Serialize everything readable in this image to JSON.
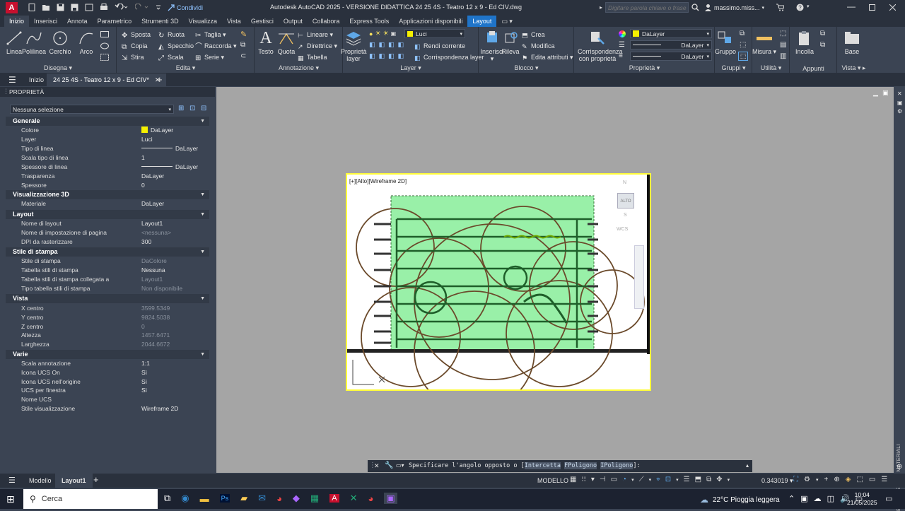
{
  "titlebar": {
    "app_logo": "A",
    "share_label": "Condividi",
    "title": "Autodesk AutoCAD 2025 - VERSIONE DIDATTICA   24 25 4S - Teatro 12 x 9 - Ed CIV.dwg",
    "search_placeholder": "Digitare parola chiave o frase",
    "user": "massimo.miss...",
    "icons": [
      "open-icon",
      "save-icon",
      "print-icon",
      "undo-icon",
      "redo-icon",
      "share-icon",
      "search-icon",
      "user-icon",
      "cart-icon",
      "help-icon",
      "minimize-icon",
      "maximize-icon",
      "close-icon"
    ]
  },
  "ribbon_tabs": [
    "Inizio",
    "Inserisci",
    "Annota",
    "Parametrico",
    "Strumenti 3D",
    "Visualizza",
    "Vista",
    "Gestisci",
    "Output",
    "Collabora",
    "Express Tools",
    "Applicazioni disponibili",
    "Layout"
  ],
  "ribbon": {
    "disegna": {
      "title": "Disegna",
      "linea": "Linea",
      "polilinea": "Polilinea",
      "cerchio": "Cerchio",
      "arco": "Arco"
    },
    "edita": {
      "title": "Edita",
      "sposta": "Sposta",
      "ruota": "Ruota",
      "taglia": "Taglia",
      "copia": "Copia",
      "specchio": "Specchio",
      "raccorda": "Raccorda",
      "stira": "Stira",
      "scala": "Scala",
      "serie": "Serie"
    },
    "annotazione": {
      "title": "Annotazione",
      "testo": "Testo",
      "quota": "Quota",
      "lineare": "Lineare",
      "direttrice": "Direttrice",
      "tabella": "Tabella"
    },
    "layer": {
      "title": "Layer",
      "proprieta": "Proprietà layer",
      "current": "Luci",
      "rendi": "Rendi corrente",
      "corrisp": "Corrispondenza layer"
    },
    "blocco": {
      "title": "Blocco",
      "inserisci": "Inserisci",
      "rileva": "Rileva",
      "crea": "Crea",
      "modifica": "Modifica",
      "edita_attr": "Edita attributi"
    },
    "proprieta": {
      "title": "Proprietà",
      "corrisp": "Corrispondenza con proprietà",
      "color": "DaLayer",
      "linetype": "DaLayer",
      "lineweight": "DaLayer"
    },
    "gruppi": {
      "title": "Gruppi",
      "gruppo": "Gruppo"
    },
    "utilita": {
      "title": "Utilità",
      "misura": "Misura"
    },
    "appunti": {
      "title": "Appunti",
      "incolla": "Incolla"
    },
    "vista": {
      "title": "Vista",
      "base": "Base"
    }
  },
  "doctabs": {
    "home": "Inizio",
    "active": "24 25 4S - Teatro 12 x 9 - Ed CIV*"
  },
  "properties": {
    "title": "PROPRIETÀ",
    "selection": "Nessuna selezione",
    "sections": {
      "generale": "Generale",
      "vis3d": "Visualizzazione 3D",
      "layout": "Layout",
      "stile": "Stile di stampa",
      "vista": "Vista",
      "varie": "Varie"
    },
    "rows": {
      "colore": [
        "Colore",
        "DaLayer"
      ],
      "layer": [
        "Layer",
        "Luci"
      ],
      "tipolinea": [
        "Tipo di linea",
        "DaLayer"
      ],
      "scalatipo": [
        "Scala tipo di linea",
        "1"
      ],
      "spessore": [
        "Spessore di linea",
        "DaLayer"
      ],
      "trasparenza": [
        "Trasparenza",
        "DaLayer"
      ],
      "spessore3d": [
        "Spessore",
        "0"
      ],
      "materiale": [
        "Materiale",
        "DaLayer"
      ],
      "nomelayout": [
        "Nome di layout",
        "Layout1"
      ],
      "nomeimp": [
        "Nome di impostazione di pagina",
        "<nessuna>"
      ],
      "dpi": [
        "DPI da rasterizzare",
        "300"
      ],
      "stilestampa": [
        "Stile di stampa",
        "DaColore"
      ],
      "tabstili": [
        "Tabella stili di stampa",
        "Nessuna"
      ],
      "tabcoll": [
        "Tabella stili di stampa collegata a",
        "Layout1"
      ],
      "tipotab": [
        "Tipo tabella stili di stampa",
        "Non disponibile"
      ],
      "xcentro": [
        "X centro",
        "3599.5349"
      ],
      "ycentro": [
        "Y centro",
        "9824.5038"
      ],
      "zcentro": [
        "Z centro",
        "0"
      ],
      "altezza": [
        "Altezza",
        "1457.6471"
      ],
      "larghezza": [
        "Larghezza",
        "2044.6672"
      ],
      "scalaann": [
        "Scala annotazione",
        "1:1"
      ],
      "ucson": [
        "Icona UCS On",
        "Sì"
      ],
      "ucsorig": [
        "Icona UCS nell'origine",
        "Sì"
      ],
      "ucsfin": [
        "UCS per finestra",
        "Sì"
      ],
      "nomeucs": [
        "Nome UCS",
        ""
      ],
      "stilevis": [
        "Stile visualizzazione",
        "Wireframe 2D"
      ]
    }
  },
  "viewport": {
    "label": "[+][Alto][Wireframe 2D]",
    "viewcube_label": "ALTO",
    "wcs": "WCS",
    "n": "N",
    "s": "S"
  },
  "command": {
    "prompt": "Specificare l'angolo opposto o [",
    "opt1": "Intercetta",
    "opt2": "FPoligono",
    "opt3": "IPoligono",
    "end": "]:"
  },
  "status": {
    "model_tab": "Modello",
    "layout_tab": "Layout1",
    "mode": "MODELLO",
    "scale": "0.343019"
  },
  "right_palette": {
    "label": "BROWSER DEI MATERIALI"
  },
  "taskbar": {
    "search": "Cerca",
    "weather": "22°C  Pioggia leggera",
    "time": "10:04",
    "date": "21/05/2025"
  },
  "colors": {
    "accent": "#1f74c9",
    "bg": "#3b4453",
    "dark": "#2a313d",
    "sheet_border": "#fffc3a",
    "selection": "#99f0a8"
  }
}
